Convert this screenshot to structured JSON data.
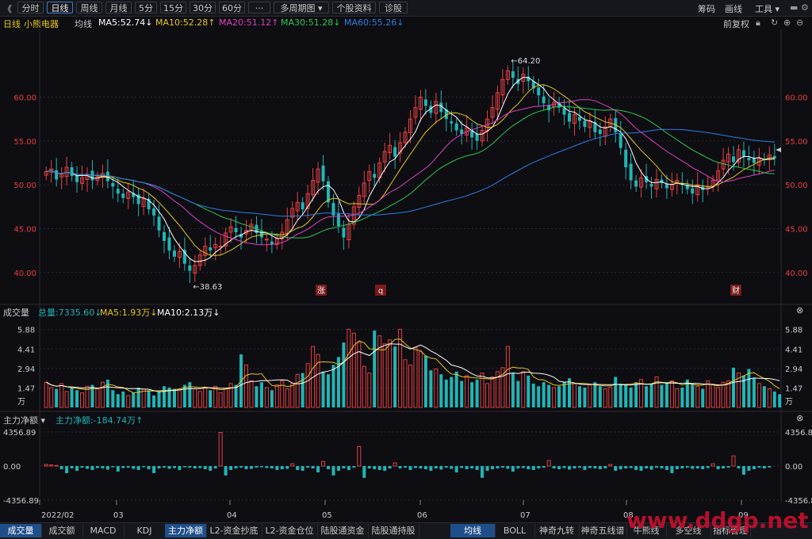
{
  "toolbar": {
    "back": "《",
    "periods": [
      "分时",
      "日线",
      "周线",
      "月线",
      "5分",
      "15分",
      "30分",
      "60分",
      "···",
      "多周期图 ▾",
      "个股资料",
      "诊股"
    ],
    "active_index": 1,
    "right": [
      "筹码",
      "画线",
      "工具 ▾"
    ]
  },
  "info": {
    "period": "日线",
    "stock_name": "小熊电器",
    "ma_label": "均线",
    "ma5": "MA5:52.74↓",
    "ma10": "MA10:52.28↑",
    "ma20": "MA20:51.12↑",
    "ma30": "MA30:51.28↓",
    "ma60": "MA60:55.26↓",
    "fuquan": "前复权"
  },
  "price_axis": {
    "ticks": [
      "60.00",
      "55.00",
      "50.00",
      "45.00",
      "40.00"
    ],
    "high_label": "64.20",
    "low_label": "38.63"
  },
  "price_markers": [
    "涨",
    "q",
    "财"
  ],
  "volume": {
    "title": "成交量",
    "total": "总量:7335.60↓",
    "ma5": "MA5:1.93万↓",
    "ma10": "MA10:2.13万↓",
    "ticks": [
      "5.88",
      "4.41",
      "2.94",
      "1.47",
      "万"
    ]
  },
  "net": {
    "title": "主力净额 ▾",
    "value": "主力净额:-184.74万↑",
    "ticks_left": [
      "4356.89",
      "0.00",
      "-4356.89"
    ],
    "ticks_right": [
      "4356.8",
      "0.00",
      "-4356.8"
    ]
  },
  "dates": [
    "2022/02",
    "03",
    "04",
    "05",
    "06",
    "07",
    "08",
    "09"
  ],
  "bottom_tabs_left": [
    "成交量",
    "成交额",
    "MACD",
    "KDJ",
    "主力净额",
    "L2-资金抄底",
    "L2-资金仓位",
    "陆股通资金",
    "陆股通持股"
  ],
  "bottom_tabs_right": [
    "均线",
    "BOLL",
    "神奇九转",
    "神奇五线谱",
    "牛熊线",
    "多空线",
    "指标管理"
  ],
  "watermark": "www.ddgp.net",
  "colors": {
    "up": "#e84040",
    "down": "#22b5b5",
    "ma5": "#ffffff",
    "ma10": "#e8c820",
    "ma20": "#e040c0",
    "ma30": "#30c850",
    "ma60": "#2e7ee0",
    "axis": "#e84040"
  },
  "chart_data": {
    "type": "candlestick",
    "title": "",
    "ylim": [
      37,
      67
    ],
    "grid": true,
    "series_names": [
      "MA5",
      "MA10",
      "MA20",
      "MA30",
      "MA60"
    ],
    "high": 64.2,
    "low": 38.63,
    "closes": [
      51.5,
      51.8,
      50.6,
      51.2,
      52.0,
      51.0,
      50.3,
      50.8,
      51.2,
      50.5,
      50.9,
      51.3,
      50.4,
      49.8,
      49.0,
      48.5,
      49.2,
      48.6,
      47.8,
      48.4,
      47.2,
      46.5,
      44.8,
      43.6,
      42.5,
      41.8,
      42.4,
      41.0,
      40.2,
      40.8,
      42.0,
      43.0,
      42.5,
      43.2,
      43.0,
      44.5,
      45.2,
      44.6,
      44.0,
      44.8,
      45.5,
      44.5,
      44.0,
      43.8,
      43.2,
      43.9,
      44.6,
      46.0,
      47.3,
      48.0,
      47.2,
      49.0,
      50.5,
      51.8,
      50.4,
      48.0,
      46.5,
      45.3,
      44.0,
      45.5,
      47.5,
      48.8,
      50.2,
      51.5,
      50.8,
      52.5,
      53.8,
      54.5,
      53.2,
      54.8,
      56.0,
      57.5,
      58.8,
      60.0,
      59.0,
      58.2,
      59.5,
      58.3,
      57.5,
      57.0,
      56.2,
      55.8,
      56.5,
      55.4,
      55.0,
      56.2,
      57.5,
      58.8,
      60.5,
      62.0,
      63.0,
      62.2,
      61.5,
      62.6,
      61.8,
      61.0,
      60.2,
      59.3,
      58.5,
      59.4,
      58.8,
      58.0,
      57.2,
      58.0,
      57.3,
      56.6,
      57.3,
      56.0,
      55.8,
      56.6,
      57.5,
      56.0,
      54.2,
      52.0,
      50.5,
      49.8,
      50.8,
      50.3,
      49.8,
      50.6,
      50.2,
      49.6,
      50.0,
      50.5,
      50.0,
      49.5,
      49.0,
      50.0,
      49.4,
      49.8,
      50.5,
      51.6,
      52.8,
      53.5,
      52.6,
      54.0,
      53.2,
      52.8,
      52.5,
      53.0,
      52.8,
      53.4,
      53.0
    ],
    "volumes": [
      1.9,
      1.5,
      1.4,
      1.8,
      1.2,
      1.5,
      1.3,
      1.1,
      1.6,
      1.7,
      1.4,
      1.9,
      2.1,
      1.3,
      1.0,
      1.2,
      0.9,
      1.1,
      1.5,
      1.4,
      1.3,
      0.9,
      1.2,
      1.6,
      1.5,
      1.4,
      1.3,
      1.7,
      1.9,
      1.4,
      1.2,
      1.5,
      1.3,
      1.6,
      1.1,
      1.4,
      1.8,
      1.7,
      4.0,
      3.2,
      2.0,
      1.6,
      1.9,
      1.5,
      1.3,
      1.7,
      2.0,
      1.4,
      1.8,
      2.5,
      2.6,
      3.3,
      4.6,
      4.0,
      2.7,
      2.5,
      3.2,
      3.8,
      4.9,
      5.9,
      5.6,
      4.9,
      3.1,
      2.6,
      5.8,
      5.4,
      4.8,
      5.1,
      4.6,
      5.9,
      3.6,
      3.2,
      4.5,
      4.2,
      3.9,
      2.8,
      2.9,
      2.5,
      2.1,
      2.3,
      2.7,
      2.0,
      2.4,
      1.9,
      2.1,
      2.6,
      1.8,
      2.3,
      2.7,
      3.0,
      4.6,
      2.6,
      2.0,
      2.7,
      2.4,
      1.8,
      1.6,
      1.9,
      1.7,
      1.5,
      1.6,
      1.9,
      2.2,
      1.8,
      1.6,
      1.5,
      1.7,
      1.9,
      1.6,
      1.4,
      1.5,
      2.3,
      1.8,
      1.7,
      1.5,
      1.9,
      2.1,
      1.6,
      1.8,
      2.3,
      1.7,
      1.9,
      2.0,
      1.4,
      1.5,
      2.1,
      1.8,
      1.6,
      1.4,
      2.0,
      1.7,
      1.5,
      1.9,
      2.0,
      3.0,
      2.6,
      2.4,
      2.9,
      2.2,
      1.8,
      1.6,
      1.4,
      1.2,
      1.0
    ],
    "net_flow": [
      200,
      150,
      80,
      -400,
      -900,
      -300,
      -600,
      -200,
      -350,
      -500,
      -250,
      -300,
      -450,
      -150,
      -700,
      -250,
      -200,
      -350,
      -500,
      -150,
      -400,
      -900,
      -300,
      -200,
      -350,
      -250,
      -500,
      -150,
      -200,
      -300,
      -250,
      -400,
      -600,
      -300,
      4300,
      -1200,
      -500,
      -300,
      -200,
      -400,
      -350,
      -200,
      -150,
      -250,
      -300,
      -500,
      -400,
      -350,
      300,
      -500,
      -600,
      -200,
      -300,
      -800,
      600,
      -400,
      -1200,
      -600,
      -300,
      -500,
      -200,
      2500,
      -1500,
      -300,
      -400,
      -500,
      -600,
      -300,
      400,
      -300,
      -200,
      -500,
      -250,
      -300,
      -400,
      -600,
      -300,
      -450,
      -200,
      -350,
      -800,
      -250,
      -400,
      -300,
      -500,
      -1500,
      -600,
      -400,
      -300,
      -200,
      -350,
      -700,
      -300,
      -250,
      -400,
      -500,
      -300,
      -200,
      700,
      -300,
      -400,
      -250,
      -450,
      -300,
      -200,
      -500,
      -250,
      -300,
      -400,
      -300,
      200,
      -600,
      -400,
      -300,
      -250,
      -500,
      -600,
      -300,
      -450,
      -200,
      -300,
      -500,
      -900,
      -400,
      -300,
      -200,
      -350,
      -300,
      -400,
      -250,
      300,
      -400,
      -300,
      -200,
      1300,
      -300,
      -1100,
      -600,
      -400,
      -200,
      -300,
      -185
    ]
  }
}
